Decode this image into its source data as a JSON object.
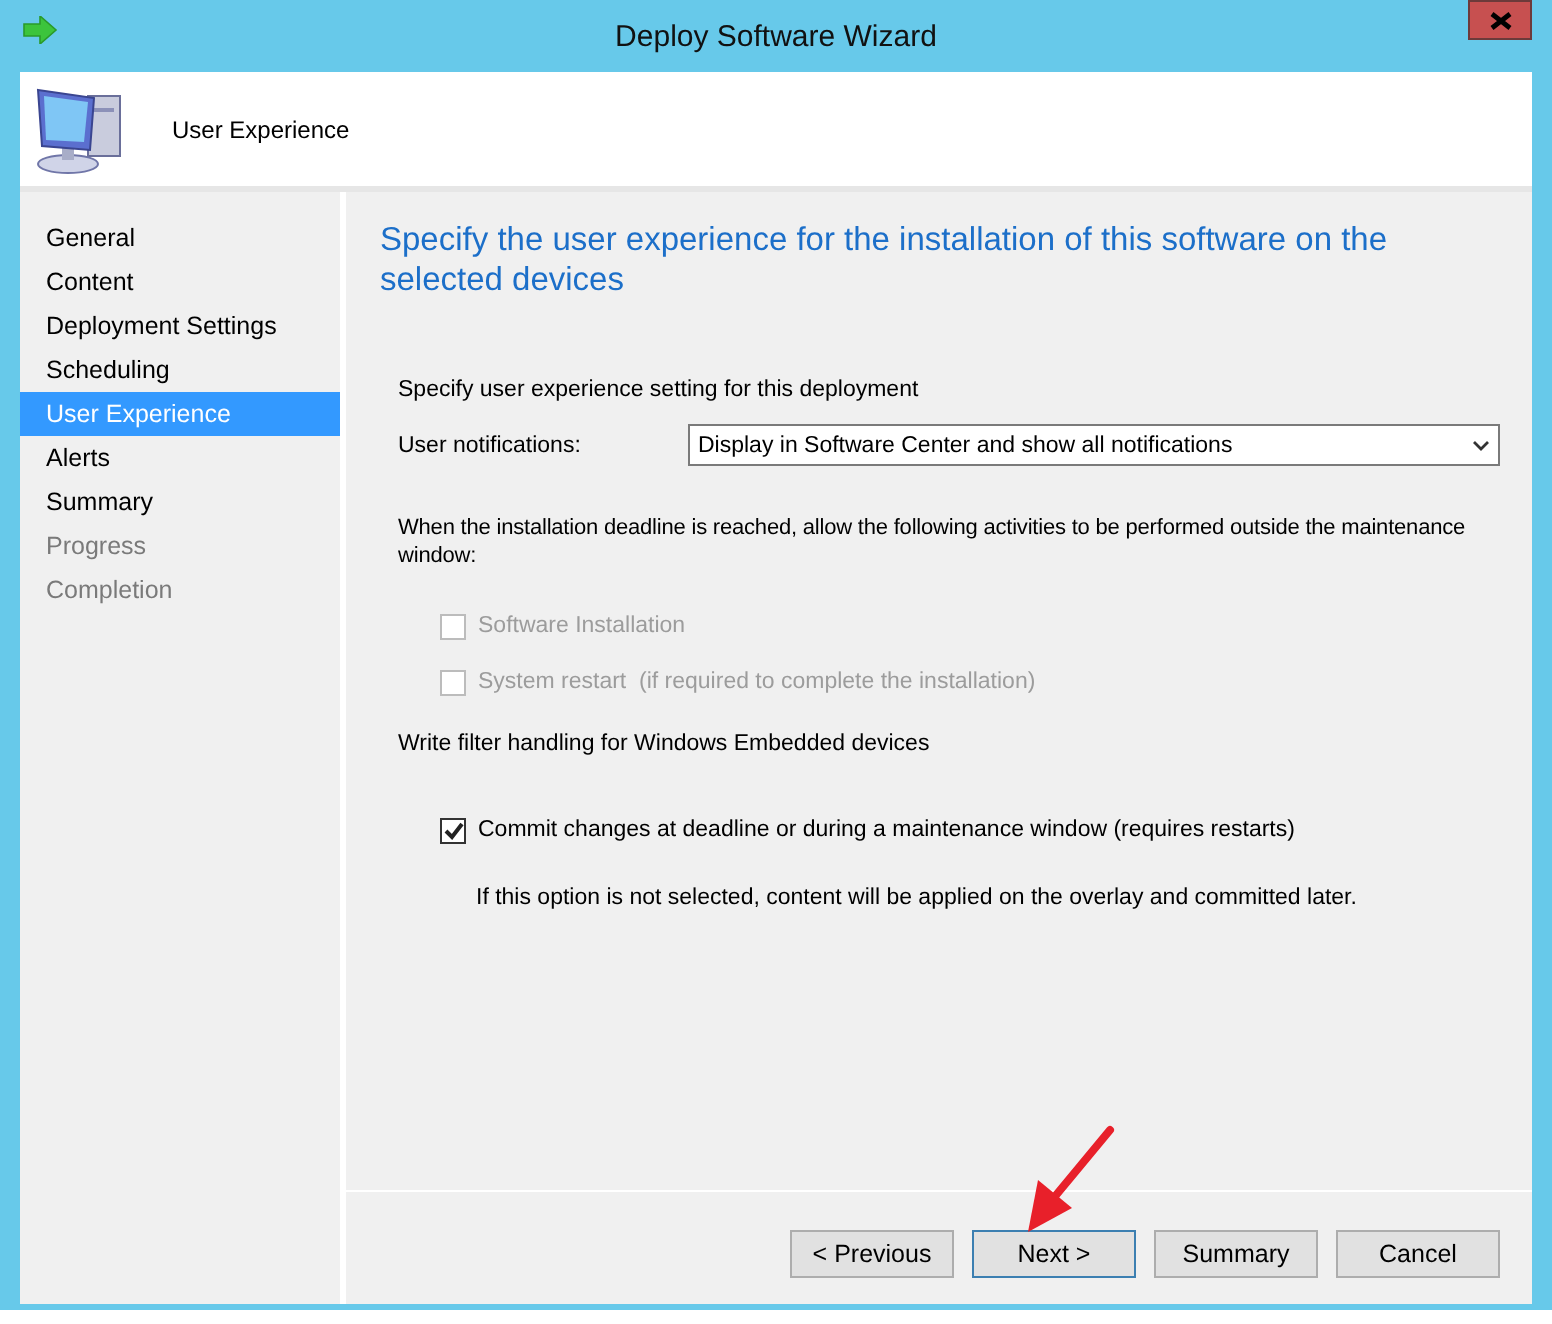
{
  "window": {
    "title": "Deploy Software Wizard"
  },
  "header": {
    "title": "User Experience"
  },
  "nav": [
    {
      "label": "General",
      "selected": false,
      "disabled": false
    },
    {
      "label": "Content",
      "selected": false,
      "disabled": false
    },
    {
      "label": "Deployment Settings",
      "selected": false,
      "disabled": false
    },
    {
      "label": "Scheduling",
      "selected": false,
      "disabled": false
    },
    {
      "label": "User Experience",
      "selected": true,
      "disabled": false
    },
    {
      "label": "Alerts",
      "selected": false,
      "disabled": false
    },
    {
      "label": "Summary",
      "selected": false,
      "disabled": false
    },
    {
      "label": "Progress",
      "selected": false,
      "disabled": true
    },
    {
      "label": "Completion",
      "selected": false,
      "disabled": true
    }
  ],
  "heading": "Specify the user experience for the installation of this software on the selected devices",
  "intro": "Specify user experience setting for this deployment",
  "notifications": {
    "label": "User notifications:",
    "value": "Display in Software Center and show all notifications"
  },
  "deadline_text": "When the installation deadline is reached, allow the following activities to be performed outside the maintenance window:",
  "deadline_options": [
    {
      "label": "Software Installation",
      "checked": false,
      "disabled": true
    },
    {
      "label": "System restart  (if required to complete the installation)",
      "checked": false,
      "disabled": true
    }
  ],
  "write_filter_text": "Write filter handling for Windows Embedded devices",
  "write_filter_option": {
    "label": "Commit changes at deadline or during a maintenance window (requires restarts)",
    "checked": true,
    "disabled": false
  },
  "write_filter_note": "If this option is not selected, content will be applied on the overlay and committed later.",
  "buttons": [
    {
      "label": "< Previous",
      "selected": false
    },
    {
      "label": "Next >",
      "selected": true
    },
    {
      "label": "Summary",
      "selected": false
    },
    {
      "label": "Cancel",
      "selected": false
    }
  ]
}
